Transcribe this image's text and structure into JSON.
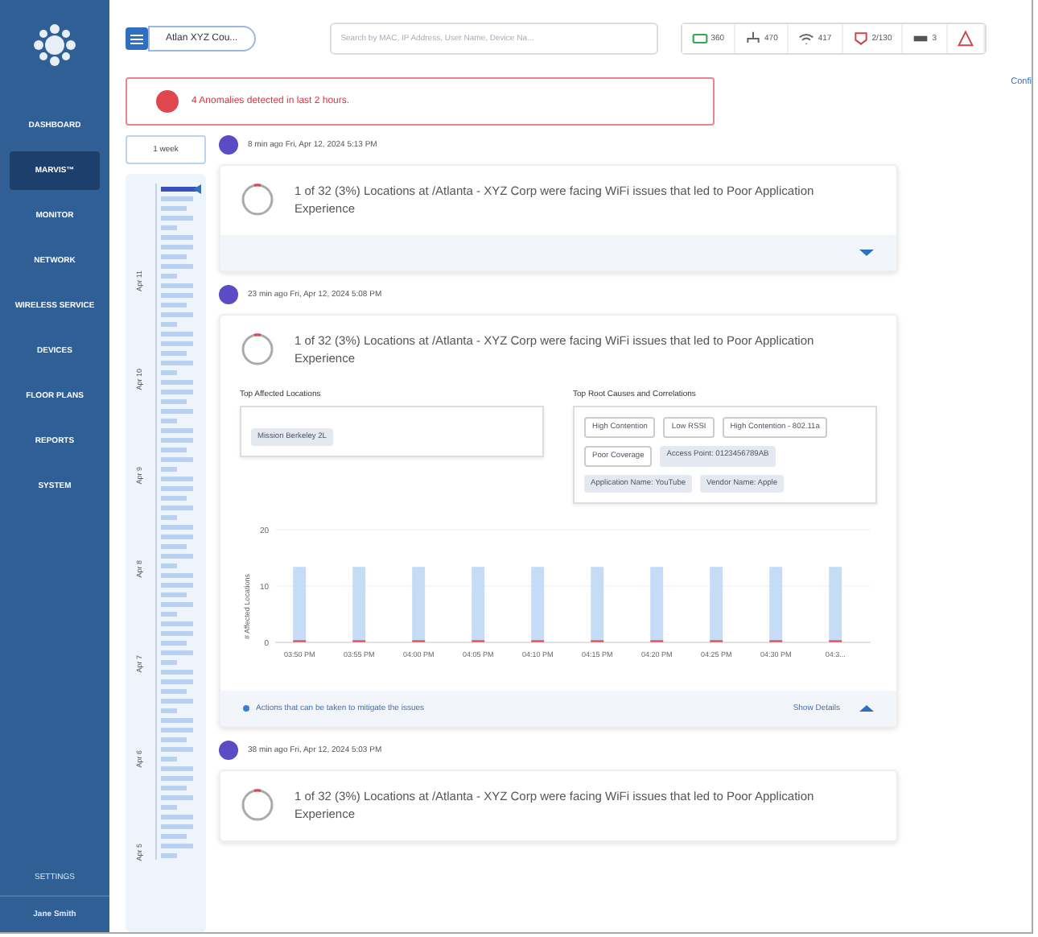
{
  "sidebar": {
    "items": [
      {
        "label": "DASHBOARD",
        "selected": false
      },
      {
        "label": "MARVIS™",
        "selected": true
      },
      {
        "label": "MONITOR",
        "selected": false
      },
      {
        "label": "NETWORK",
        "selected": false
      },
      {
        "label": "WIRELESS SERVICE",
        "selected": false
      },
      {
        "label": "DEVICES",
        "selected": false
      },
      {
        "label": "FLOOR PLANS",
        "selected": false
      },
      {
        "label": "REPORTS",
        "selected": false
      },
      {
        "label": "SYSTEM",
        "selected": false
      }
    ],
    "footer_items": [
      "SETTINGS",
      "Jane Smith"
    ]
  },
  "topbar": {
    "site": "Atlan XYZ Cou...",
    "search": {
      "placeholder": "Search by MAC, IP Address, User Name, Device Na..."
    },
    "stats": [
      {
        "kind": "device",
        "label": "360"
      },
      {
        "kind": "network",
        "label": "470"
      },
      {
        "kind": "wifi",
        "label": "417"
      },
      {
        "kind": "alert",
        "label": "2/130"
      },
      {
        "kind": "switch",
        "label": "3"
      },
      {
        "kind": "warning"
      }
    ],
    "config_link": "Confi"
  },
  "banner": {
    "text": "4 Anomalies detected in last 2 hours."
  },
  "timeline": {
    "filter": "1 week",
    "labels": [
      "Apr 11",
      "Apr 10",
      "Apr 9",
      "Apr 8",
      "Apr 7",
      "Apr 6",
      "Apr 5"
    ]
  },
  "events": [
    {
      "time": "8 min ago Fri, Apr 12, 2024 5:13 PM",
      "title": "1 of 32 (3%) Locations at /Atlanta - XYZ Corp were facing WiFi issues that led to Poor Application Experience",
      "expanded": false
    },
    {
      "time": "23 min ago Fri, Apr 12, 2024 5:08 PM",
      "title": "1 of 32 (3%) Locations at /Atlanta - XYZ Corp were facing WiFi issues that led to Poor Application Experience",
      "expanded": true,
      "locations_title": "Top Affected Locations",
      "locations": [
        "Mission Berkeley 2L"
      ],
      "causes_title": "Top Root Causes and Correlations",
      "causes": [
        {
          "label": "High Contention",
          "kind": "outline"
        },
        {
          "label": "Low RSSI",
          "kind": "outline"
        },
        {
          "label": "High Contention - 802.11a",
          "kind": "outline"
        },
        {
          "label": "Poor Coverage",
          "kind": "outline"
        },
        {
          "label": "Access Point: 0123456789AB",
          "kind": "filled"
        },
        {
          "label": "Application Name: YouTube",
          "kind": "filled"
        },
        {
          "label": "Vendor Name: Apple",
          "kind": "filled"
        }
      ],
      "chart_data": {
        "type": "bar",
        "ylabel": "# Affected Locations",
        "categories": [
          "03:50 PM",
          "03:55 PM",
          "04:00 PM",
          "04:05 PM",
          "04:10 PM",
          "04:15 PM",
          "04:20 PM",
          "04:25 PM",
          "04:30 PM",
          "04:3..."
        ],
        "stacked": true,
        "ylim": [
          0,
          20
        ],
        "yticks": [
          0,
          10,
          20
        ],
        "series": [
          {
            "color": "#e0464e",
            "values": [
              0.4,
              0.4,
              0.4,
              0.4,
              0.4,
              0.4,
              0.4,
              0.4,
              0.4,
              0.4
            ]
          },
          {
            "color": "#c5dcf7",
            "values": [
              13,
              13,
              13,
              13,
              13,
              13,
              13,
              13,
              13,
              13
            ]
          }
        ]
      },
      "actions": "Actions that can be taken to mitigate the issues",
      "details_link": "Show Details"
    },
    {
      "time": "38 min ago Fri, Apr 12, 2024 5:03 PM",
      "title": "1 of 32 (3%) Locations at /Atlanta - XYZ Corp were facing WiFi issues that led to Poor Application Experience",
      "expanded": false
    }
  ]
}
